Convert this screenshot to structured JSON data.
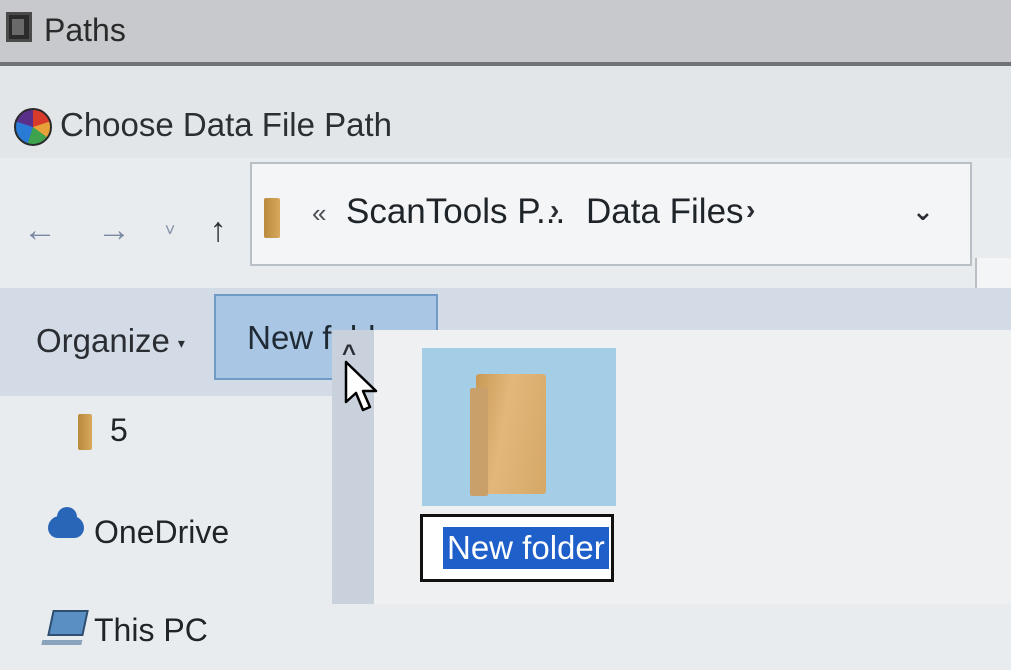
{
  "window": {
    "title": "Paths"
  },
  "dialog": {
    "title": "Choose Data File Path"
  },
  "nav": {
    "back_glyph": "←",
    "forward_glyph": "→",
    "recent_glyph": "˅",
    "up_glyph": "↑"
  },
  "address": {
    "overflow_glyph": "«",
    "crumbs": [
      "ScanTools P...",
      "Data Files"
    ],
    "separator": "›",
    "dropdown_glyph": "⌄"
  },
  "toolbar": {
    "organize_label": "Organize",
    "organize_caret": "▾",
    "new_folder_label": "New folder"
  },
  "sidebar": {
    "items": [
      {
        "label": "5",
        "icon": "folder-icon"
      },
      {
        "label": "OneDrive",
        "icon": "cloud-icon"
      },
      {
        "label": "This PC",
        "icon": "computer-icon"
      }
    ]
  },
  "scroll": {
    "up_glyph": "^"
  },
  "files": [
    {
      "name": "New folder",
      "state": "renaming"
    }
  ],
  "colors": {
    "selection": "#1e5fc9",
    "tile_highlight": "#a4cde6",
    "button_highlight": "#a9c7e4"
  }
}
